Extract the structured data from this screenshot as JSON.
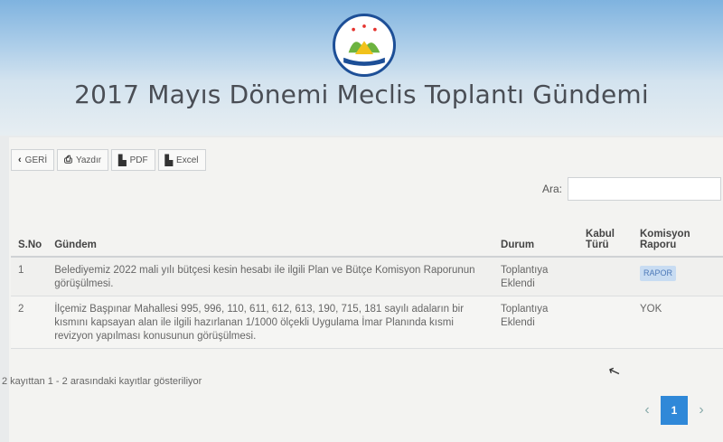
{
  "header": {
    "title": "2017 Mayıs Dönemi Meclis Toplantı Gündemi",
    "logo_text": "T.C. ERENDOĞ BELEDİYESİ"
  },
  "toolbar": {
    "back_label": "GERİ",
    "print_label": "Yazdır",
    "pdf_label": "PDF",
    "excel_label": "Excel"
  },
  "search": {
    "label": "Ara:",
    "value": "",
    "placeholder": ""
  },
  "table": {
    "columns": {
      "no": "S.No",
      "gundem": "Gündem",
      "durum": "Durum",
      "kabul": "Kabul Türü",
      "rapor": "Komisyon Raporu"
    },
    "rows": [
      {
        "no": "1",
        "gundem": "Belediyemiz 2022 mali yılı bütçesi kesin hesabı ile ilgili Plan ve Bütçe Komisyon Raporunun görüşülmesi.",
        "durum": "Toplantıya Eklendi",
        "kabul": "",
        "rapor": "RAPOR"
      },
      {
        "no": "2",
        "gundem": "İlçemiz Başpınar Mahallesi 995, 996, 110, 611, 612, 613, 190, 715, 181 sayılı adaların bir kısmını kapsayan alan ile ilgili hazırlanan 1/1000 ölçekli Uygulama İmar Planında kısmi revizyon yapılması konusunun görüşülmesi.",
        "durum": "Toplantıya Eklendi",
        "kabul": "",
        "rapor": "YOK"
      }
    ]
  },
  "footer": {
    "info_text": "2 kayıttan 1 - 2 arasındaki kayıtlar gösteriliyor",
    "prev_label": "‹",
    "current_page": "1",
    "next_label": "›"
  },
  "colors": {
    "accent": "#2f88d8",
    "badge_bg": "#c8dcf2",
    "header_top": "#7fb3df"
  },
  "icons": [
    "chevron-left-icon",
    "printer-icon",
    "pdf-file-icon",
    "excel-file-icon",
    "cursor-icon"
  ]
}
